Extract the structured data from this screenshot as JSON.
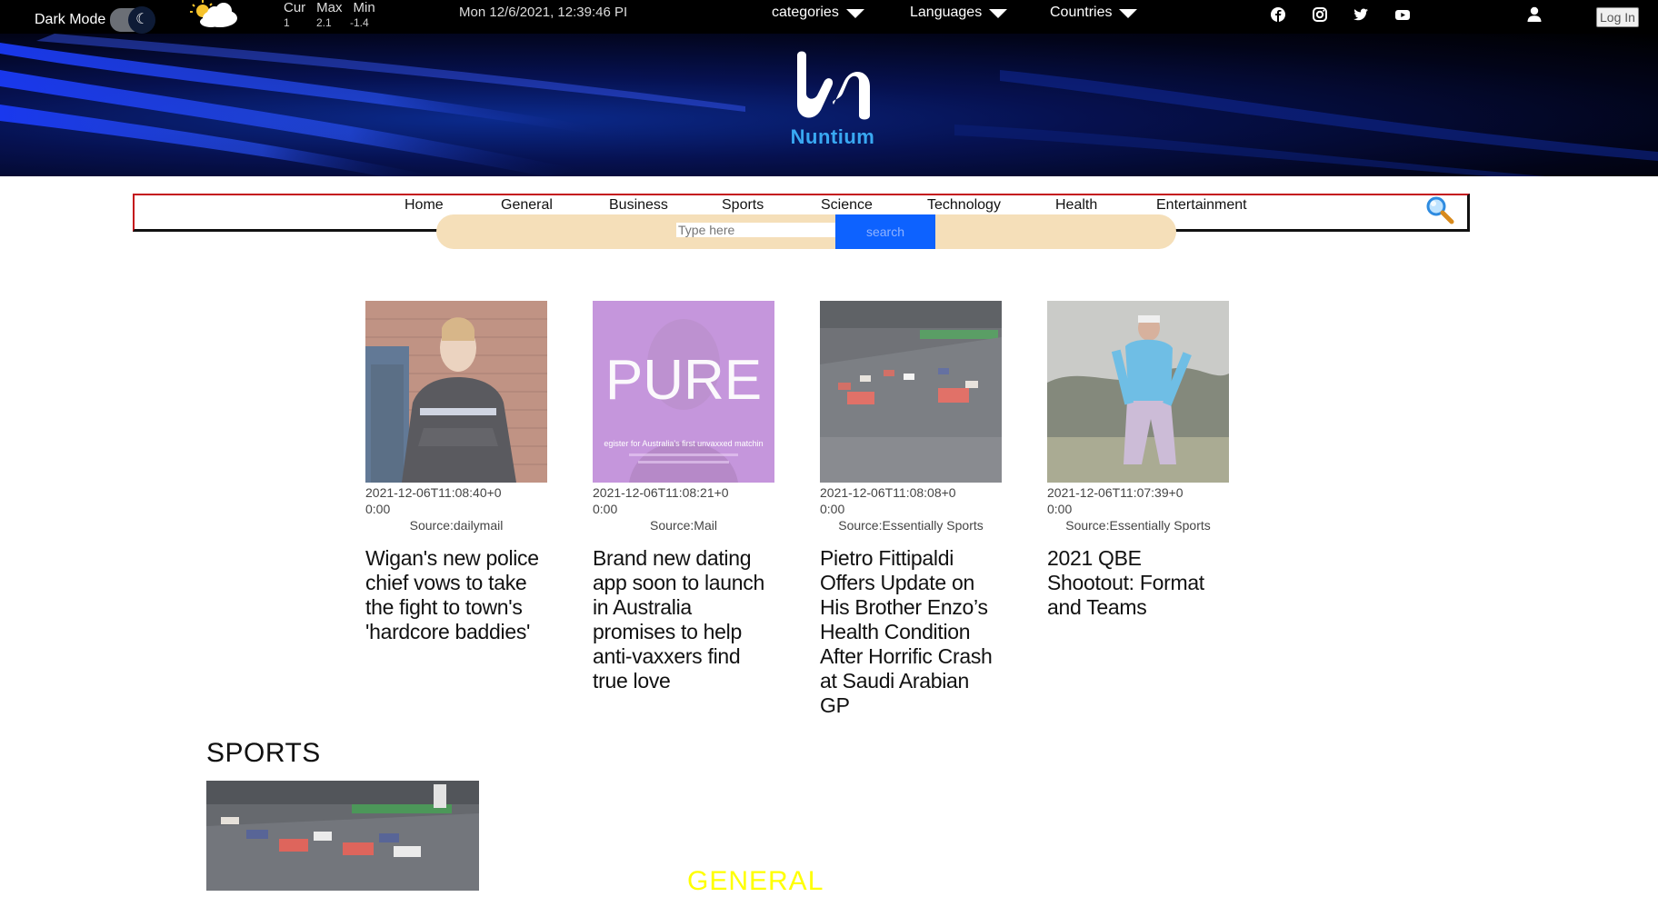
{
  "topbar": {
    "dark_mode_label": "Dark Mode",
    "weather": {
      "icon": "partly-cloudy-icon",
      "labels": [
        "Cur",
        "Max",
        "Min"
      ],
      "values": [
        "1",
        "2.1",
        "-1.4"
      ]
    },
    "datetime": "Mon 12/6/2021, 12:39:46 PI",
    "dropdowns": [
      "categories",
      "Languages",
      "Countries"
    ],
    "social_icons": [
      "facebook-icon",
      "instagram-icon",
      "twitter-icon",
      "youtube-icon"
    ],
    "user_icon": "user-icon",
    "login_label": "Log In"
  },
  "brand": {
    "name": "Nuntium",
    "primary_color": "#39a8f2"
  },
  "nav": {
    "items": [
      "Home",
      "General",
      "Business",
      "Sports",
      "Science",
      "Technology",
      "Health",
      "Entertainment"
    ],
    "border_color": "#c4131c"
  },
  "search": {
    "placeholder": "Type here",
    "button_label": "search",
    "bar_color": "#f5dfb9",
    "button_color": "#0d62ff"
  },
  "articles": [
    {
      "date": "2021-12-06T11:08:40+00:00",
      "source": "Source:dailymail",
      "headline": "Wigan's new police chief vows to take the fight to town's 'hardcore baddies'"
    },
    {
      "date": "2021-12-06T11:08:21+00:00",
      "source": "Source:Mail",
      "headline": "Brand new dating app soon to launch in Australia promises to help anti-vaxxers find true love",
      "image_text": "PURE",
      "image_subtext": "egister for Australia's first unvaxxed matchin"
    },
    {
      "date": "2021-12-06T11:08:08+00:00",
      "source": "Source:Essentially Sports",
      "headline": "Pietro Fittipaldi Offers Update on His Brother Enzo’s Health Condition After Horrific Crash at Saudi Arabian GP"
    },
    {
      "date": "2021-12-06T11:07:39+00:00",
      "source": "Source:Essentially Sports",
      "headline": "2021 QBE Shootout: Format and Teams"
    }
  ],
  "sections": {
    "sports_heading": "SPORTS",
    "general_heading": "GENERAL",
    "general_color": "#ffff00"
  }
}
